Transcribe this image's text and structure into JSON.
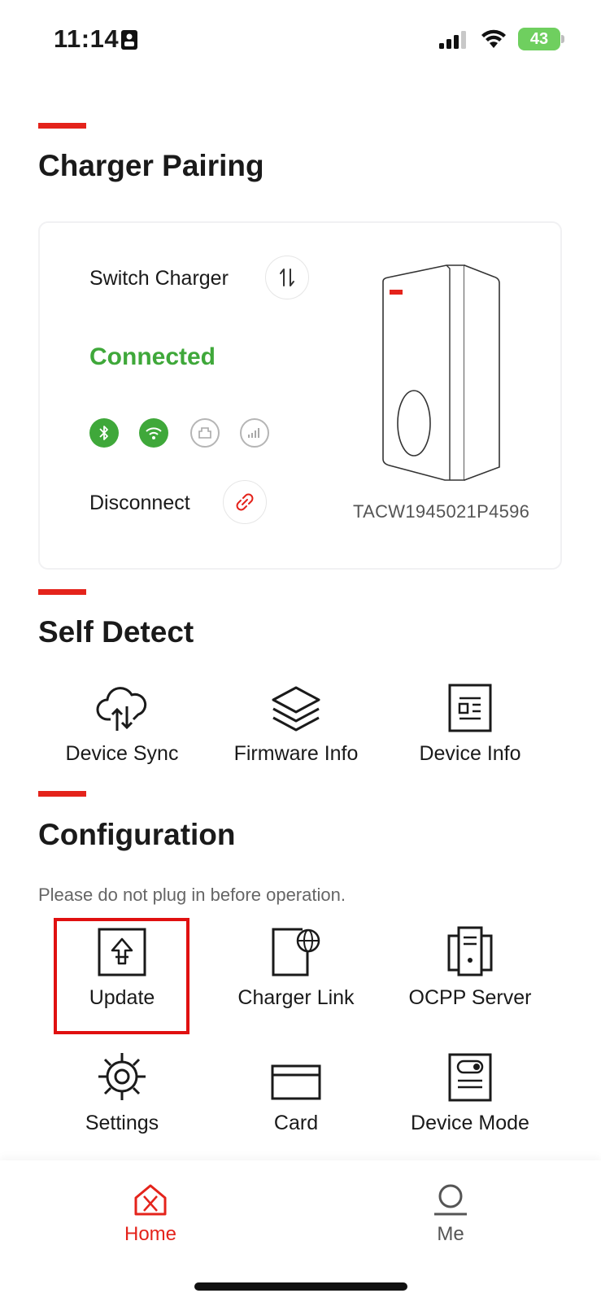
{
  "status_bar": {
    "time": "11:14",
    "battery": "43"
  },
  "pairing": {
    "title": "Charger Pairing",
    "switch_label": "Switch Charger",
    "status": "Connected",
    "disconnect_label": "Disconnect",
    "serial": "TACW1945021P4596",
    "indicators": [
      {
        "icon": "bluetooth-icon",
        "active": true
      },
      {
        "icon": "wifi-icon",
        "active": true
      },
      {
        "icon": "ethernet-icon",
        "active": false
      },
      {
        "icon": "cellular-icon",
        "active": false
      }
    ]
  },
  "self_detect": {
    "title": "Self Detect",
    "items": [
      {
        "label": "Device Sync",
        "icon": "cloud-sync-icon"
      },
      {
        "label": "Firmware Info",
        "icon": "layers-icon"
      },
      {
        "label": "Device Info",
        "icon": "document-icon"
      }
    ]
  },
  "configuration": {
    "title": "Configuration",
    "subtitle": "Please do not plug in before operation.",
    "items": [
      {
        "label": "Update",
        "icon": "upload-icon"
      },
      {
        "label": "Charger Link",
        "icon": "charger-link-icon"
      },
      {
        "label": "OCPP Server",
        "icon": "server-icon"
      },
      {
        "label": "Settings",
        "icon": "gear-icon"
      },
      {
        "label": "Card",
        "icon": "card-icon"
      },
      {
        "label": "Device Mode",
        "icon": "device-mode-icon"
      }
    ]
  },
  "tabbar": {
    "home": "Home",
    "me": "Me"
  },
  "colors": {
    "accent": "#e4231b",
    "connected": "#3fa83a"
  }
}
